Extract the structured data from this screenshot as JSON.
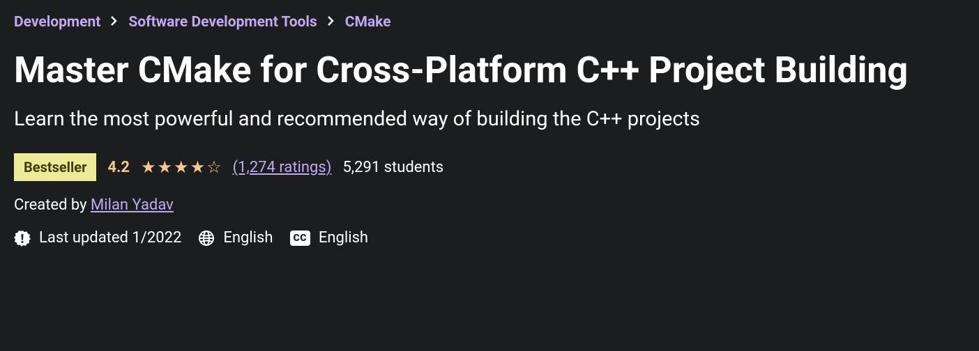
{
  "breadcrumb": {
    "items": [
      {
        "label": "Development"
      },
      {
        "label": "Software Development Tools"
      },
      {
        "label": "CMake"
      }
    ]
  },
  "course": {
    "title": "Master CMake for Cross-Platform C++ Project Building",
    "subtitle": "Learn the most powerful and recommended way of building the C++ projects"
  },
  "badge": {
    "bestseller": "Bestseller"
  },
  "rating": {
    "value": "4.2",
    "link": "(1,274 ratings)",
    "students": "5,291 students"
  },
  "creator": {
    "label": "Created by ",
    "name": "Milan Yadav"
  },
  "info": {
    "updated": "Last updated 1/2022",
    "language": "English",
    "captions": "English",
    "cc_label": "CC"
  }
}
